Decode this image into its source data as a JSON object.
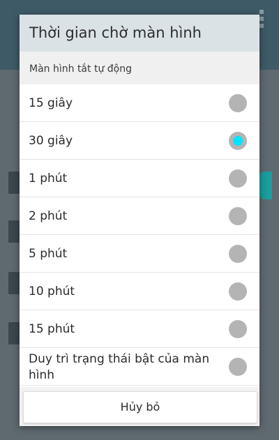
{
  "dialog": {
    "title": "Thời gian chờ màn hình",
    "subhead": "Màn hình tắt tự động",
    "options": [
      {
        "label": "15 giây",
        "selected": false
      },
      {
        "label": "30 giây",
        "selected": true
      },
      {
        "label": "1 phút",
        "selected": false
      },
      {
        "label": "2 phút",
        "selected": false
      },
      {
        "label": "5 phút",
        "selected": false
      },
      {
        "label": "10 phút",
        "selected": false
      },
      {
        "label": "15 phút",
        "selected": false
      },
      {
        "label": "Duy trì trạng thái bật của màn hình",
        "selected": false
      }
    ],
    "cancel_label": "Hủy bỏ"
  },
  "colors": {
    "title_bg": "#dbe2e6",
    "radio_selected": "#00e5ff",
    "radio_unselected": "#b4b4b4"
  }
}
